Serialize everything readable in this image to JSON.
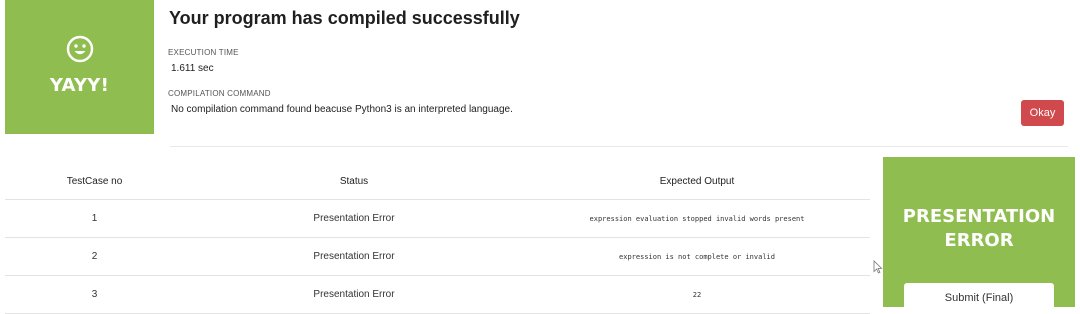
{
  "success_banner": {
    "label": "YAYY!",
    "icon": "smile-icon"
  },
  "compile_panel": {
    "title": "Your program has compiled successfully",
    "execution_time_label": "EXECUTION TIME",
    "execution_time_value": "1.611 sec",
    "compilation_command_label": "COMPILATION COMMAND",
    "compilation_command_value": "No compilation command found beacuse Python3 is an interpreted language.",
    "okay_label": "Okay"
  },
  "results_table": {
    "headers": [
      "TestCase no",
      "Status",
      "Expected Output"
    ],
    "rows": [
      {
        "testcase": "1",
        "status": "Presentation Error",
        "expected": "expression evaluation stopped invalid words present"
      },
      {
        "testcase": "2",
        "status": "Presentation Error",
        "expected": "expression is not complete or invalid"
      },
      {
        "testcase": "3",
        "status": "Presentation Error",
        "expected": "22"
      }
    ]
  },
  "verdict_panel": {
    "line1": "PRESENTATION",
    "line2": "ERROR",
    "submit_label": "Submit (Final)"
  },
  "colors": {
    "success_green": "#8fbd4f",
    "okay_red": "#d0494c"
  }
}
